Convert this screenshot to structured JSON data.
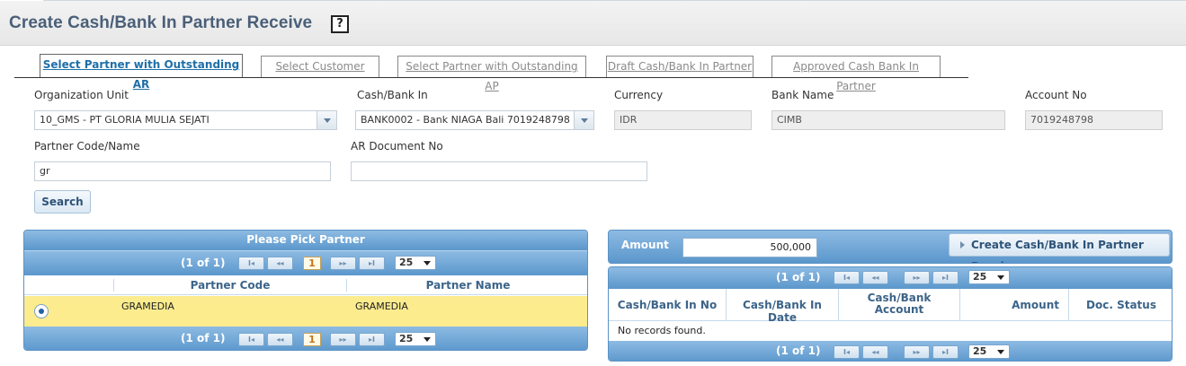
{
  "page": {
    "title": "Create Cash/Bank In Partner Receive",
    "help": "?"
  },
  "tabs": [
    {
      "label": "Select Partner with Outstanding AR"
    },
    {
      "label": "Select Customer"
    },
    {
      "label": "Select Partner with Outstanding AP"
    },
    {
      "label": "Draft Cash/Bank In Partner"
    },
    {
      "label": "Approved Cash Bank In Partner"
    }
  ],
  "form": {
    "org_unit": {
      "label": "Organization Unit",
      "value": "10_GMS - PT GLORIA MULIA SEJATI"
    },
    "cash_bank": {
      "label": "Cash/Bank In",
      "value": "BANK0002 - Bank NIAGA Bali 7019248798"
    },
    "currency": {
      "label": "Currency",
      "value": "IDR"
    },
    "bank_name": {
      "label": "Bank Name",
      "value": "CIMB"
    },
    "account_no": {
      "label": "Account No",
      "value": "7019248798"
    },
    "partner": {
      "label": "Partner Code/Name",
      "value": "gr"
    },
    "ar_doc": {
      "label": "AR Document No",
      "value": ""
    },
    "search_label": "Search"
  },
  "partner_panel": {
    "title": "Please Pick Partner",
    "pager": {
      "info": "(1 of 1)",
      "page": "1",
      "per_page": "25",
      "first": "I◂",
      "prev": "◂◂",
      "next": "▸▸",
      "last": "▸I"
    },
    "columns": [
      "Partner Code",
      "Partner Name"
    ],
    "rows": [
      {
        "code": "GRAMEDIA",
        "name": "GRAMEDIA",
        "selected": true
      }
    ]
  },
  "receive_panel": {
    "amount_label": "Amount",
    "amount_value": "500,000",
    "create_label": "Create Cash/Bank In Partner Receive",
    "pager": {
      "info": "(1 of 1)",
      "per_page": "25",
      "first": "I◂",
      "prev": "◂◂",
      "next": "▸▸",
      "last": "▸I"
    },
    "columns": [
      "Cash/Bank In No",
      "Cash/Bank In Date",
      "Cash/Bank Account",
      "Amount",
      "Doc. Status"
    ],
    "empty_message": "No records found."
  }
}
